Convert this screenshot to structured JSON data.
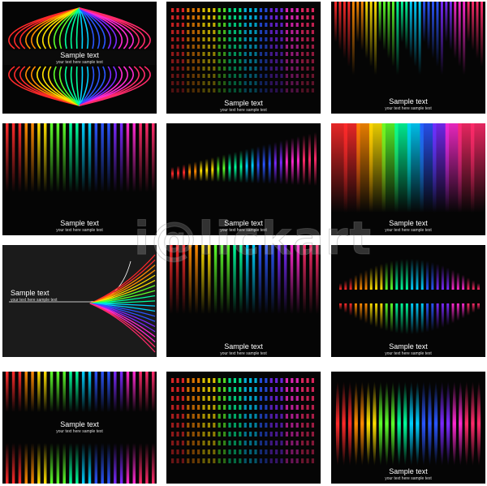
{
  "sample": {
    "title": "Sample text",
    "subtitle": "your text here sample text"
  },
  "watermark": "i@lickart",
  "palette": [
    "#ff2a2a",
    "#ff8a00",
    "#ffe000",
    "#5cff2a",
    "#00ff9c",
    "#00d0ff",
    "#2a56ff",
    "#7a2aff",
    "#ff2ad0",
    "#ff2a6a"
  ]
}
